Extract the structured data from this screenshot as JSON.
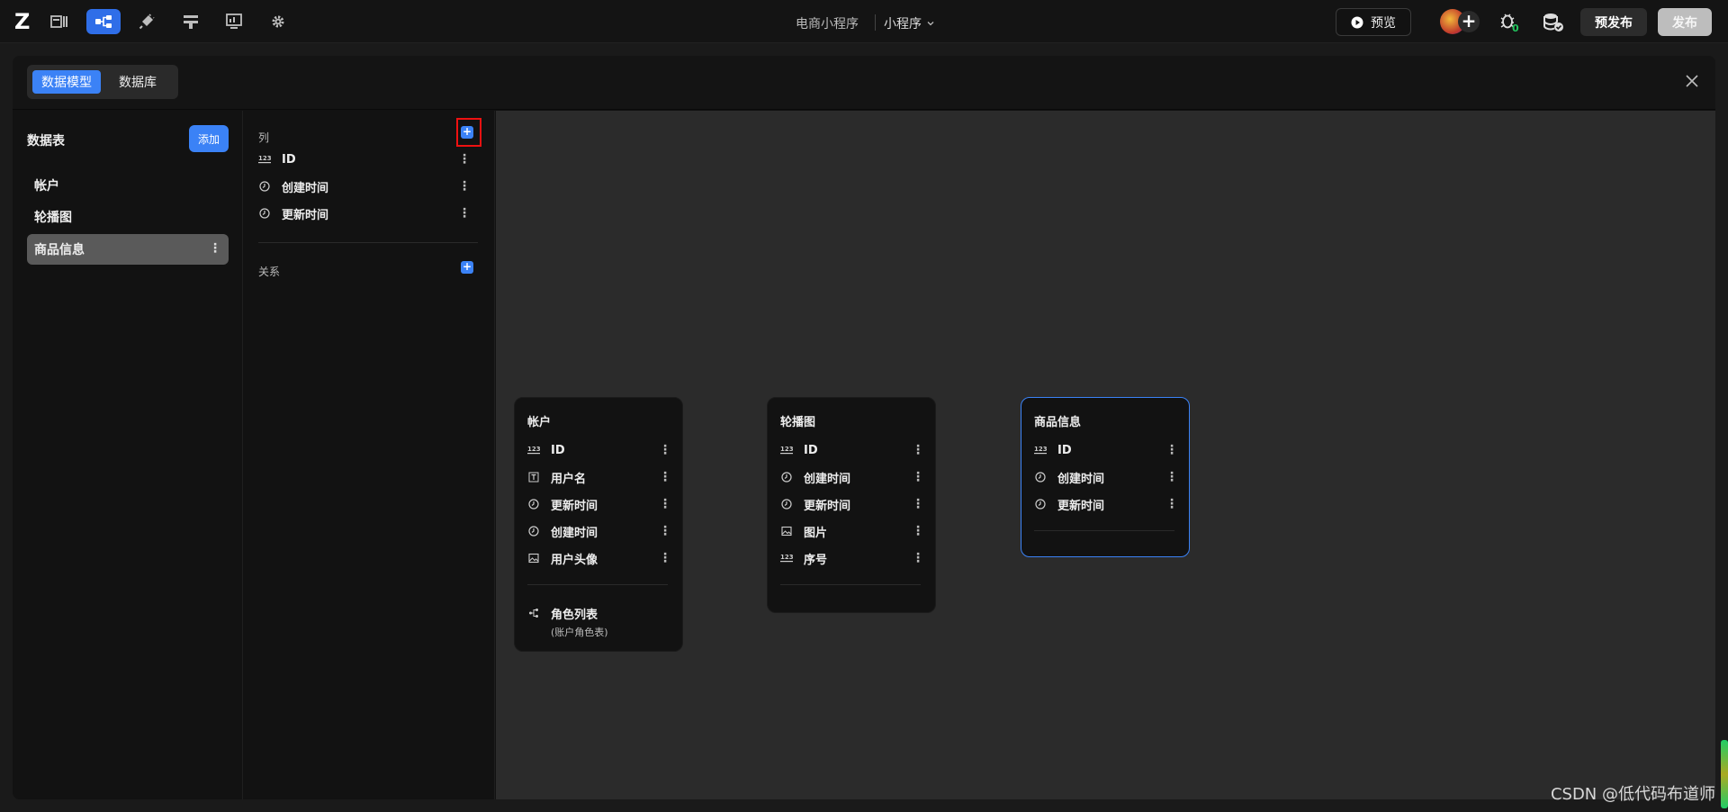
{
  "header": {
    "logo": "Z",
    "app_name": "电商小程序",
    "platform": "小程序",
    "preview_label": "预览",
    "prepublish_label": "预发布",
    "publish_label": "发布",
    "bug_count": "0"
  },
  "panel": {
    "tabs": [
      {
        "label": "数据模型",
        "active": true
      },
      {
        "label": "数据库",
        "active": false
      }
    ]
  },
  "tables": {
    "title": "数据表",
    "add_label": "添加",
    "items": [
      {
        "label": "帐户",
        "active": false
      },
      {
        "label": "轮播图",
        "active": false
      },
      {
        "label": "商品信息",
        "active": true
      }
    ]
  },
  "detail": {
    "columns_title": "列",
    "relations_title": "关系",
    "columns": [
      {
        "name": "ID",
        "icon": "number-icon"
      },
      {
        "name": "创建时间",
        "icon": "clock-icon"
      },
      {
        "name": "更新时间",
        "icon": "clock-icon"
      }
    ]
  },
  "cards": [
    {
      "title": "帐户",
      "selected": false,
      "fields": [
        {
          "name": "ID",
          "icon": "number-icon"
        },
        {
          "name": "用户名",
          "icon": "text-icon"
        },
        {
          "name": "更新时间",
          "icon": "clock-icon"
        },
        {
          "name": "创建时间",
          "icon": "clock-icon"
        },
        {
          "name": "用户头像",
          "icon": "image-icon"
        }
      ],
      "relation": {
        "name": "角色列表",
        "sub": "(账户角色表)"
      }
    },
    {
      "title": "轮播图",
      "selected": false,
      "fields": [
        {
          "name": "ID",
          "icon": "number-icon"
        },
        {
          "name": "创建时间",
          "icon": "clock-icon"
        },
        {
          "name": "更新时间",
          "icon": "clock-icon"
        },
        {
          "name": "图片",
          "icon": "image-icon"
        },
        {
          "name": "序号",
          "icon": "number-icon"
        }
      ]
    },
    {
      "title": "商品信息",
      "selected": true,
      "fields": [
        {
          "name": "ID",
          "icon": "number-icon"
        },
        {
          "name": "创建时间",
          "icon": "clock-icon"
        },
        {
          "name": "更新时间",
          "icon": "clock-icon"
        }
      ]
    }
  ],
  "watermark": "CSDN @低代码布道师",
  "colors": {
    "accent": "#3b82f6",
    "highlight": "#ee1111"
  }
}
